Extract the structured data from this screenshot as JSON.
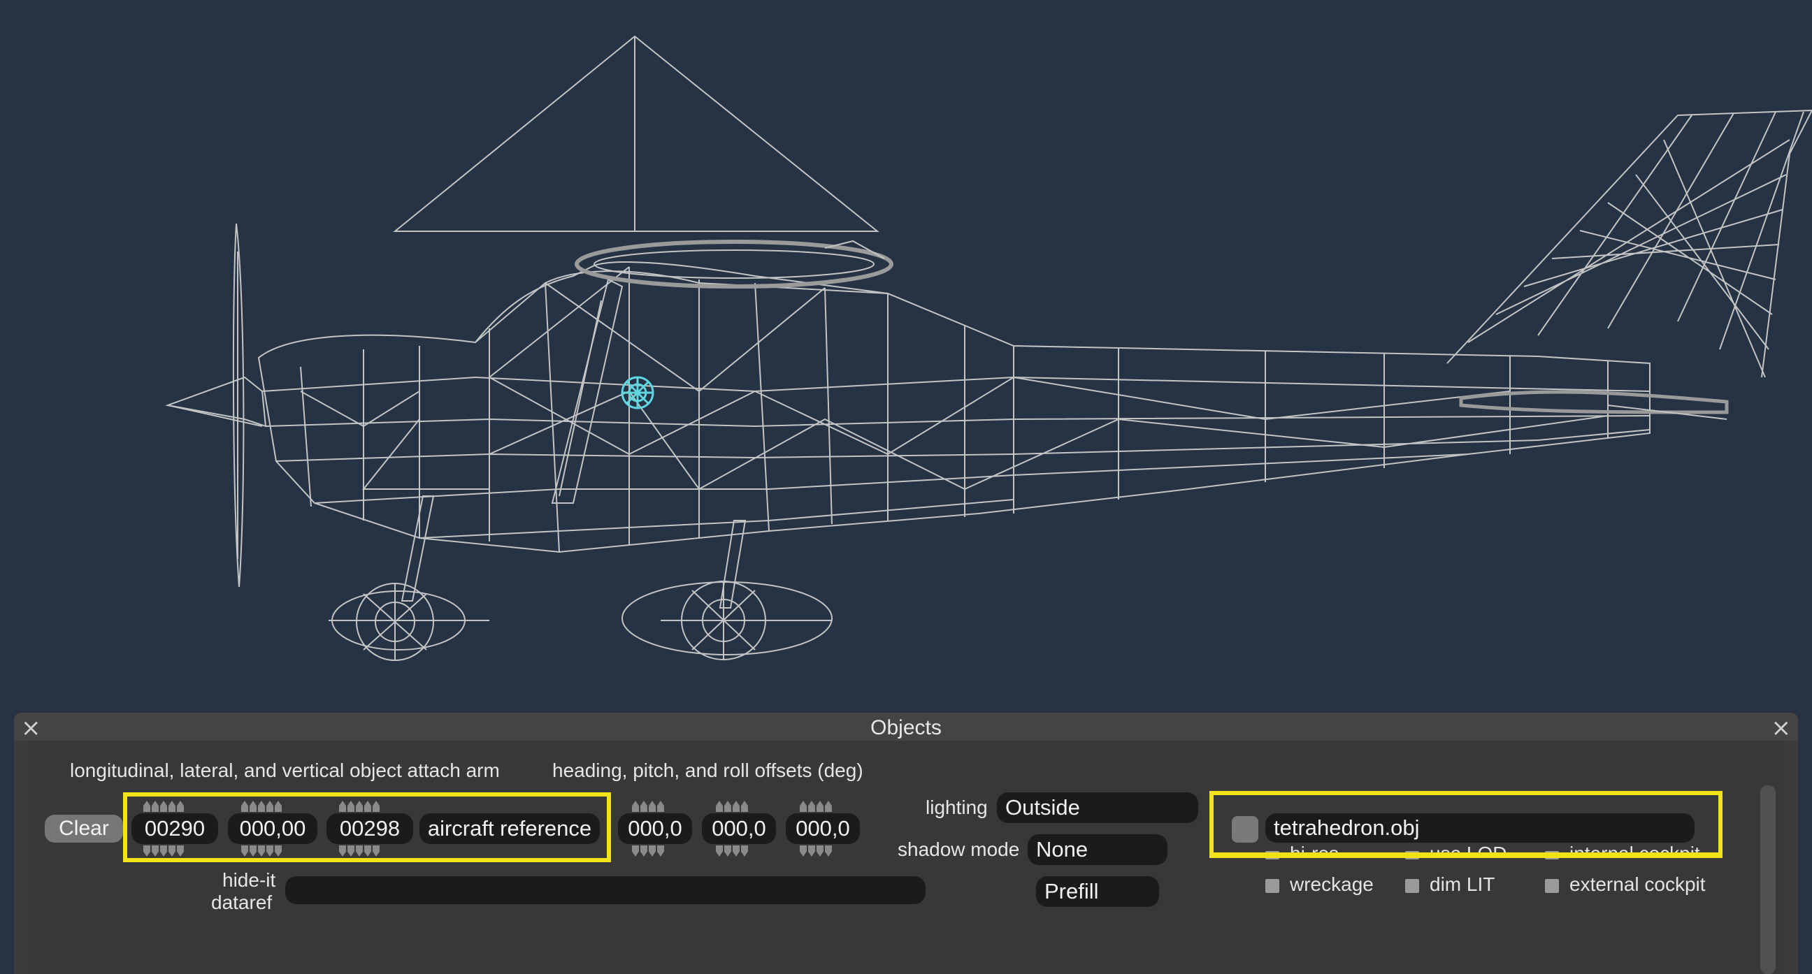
{
  "window": {
    "title": "Objects",
    "close_left": "×",
    "close_right": "×"
  },
  "labels": {
    "attach_arm": "longitudinal, lateral, and vertical object attach arm",
    "offsets": "heading, pitch, and roll offsets (deg)",
    "lighting": "lighting",
    "shadow_mode": "shadow mode",
    "hide_it": "hide-it",
    "dataref": "dataref"
  },
  "buttons": {
    "clear": "Clear",
    "prefill": "Prefill"
  },
  "arm": {
    "longitudinal": "00290",
    "lateral": "000,00",
    "vertical": "00298",
    "reference": "aircraft reference"
  },
  "offsets": {
    "heading": "000,0",
    "pitch": "000,0",
    "roll": "000,0"
  },
  "lighting_value": "Outside",
  "shadow_value": "None",
  "hide_it_dataref_value": "",
  "object_file": "tetrahedron.obj",
  "checkboxes": {
    "hi_res": "hi-res",
    "use_lod": "use LOD",
    "internal_cockpit": "internal cockpit",
    "wreckage": "wreckage",
    "dim_lit": "dim LIT",
    "external_cockpit": "external cockpit"
  },
  "colors": {
    "background": "#263345",
    "wireframe": "#c8c8c8",
    "highlight": "#f2e21a",
    "marker": "#5fd6e0"
  }
}
